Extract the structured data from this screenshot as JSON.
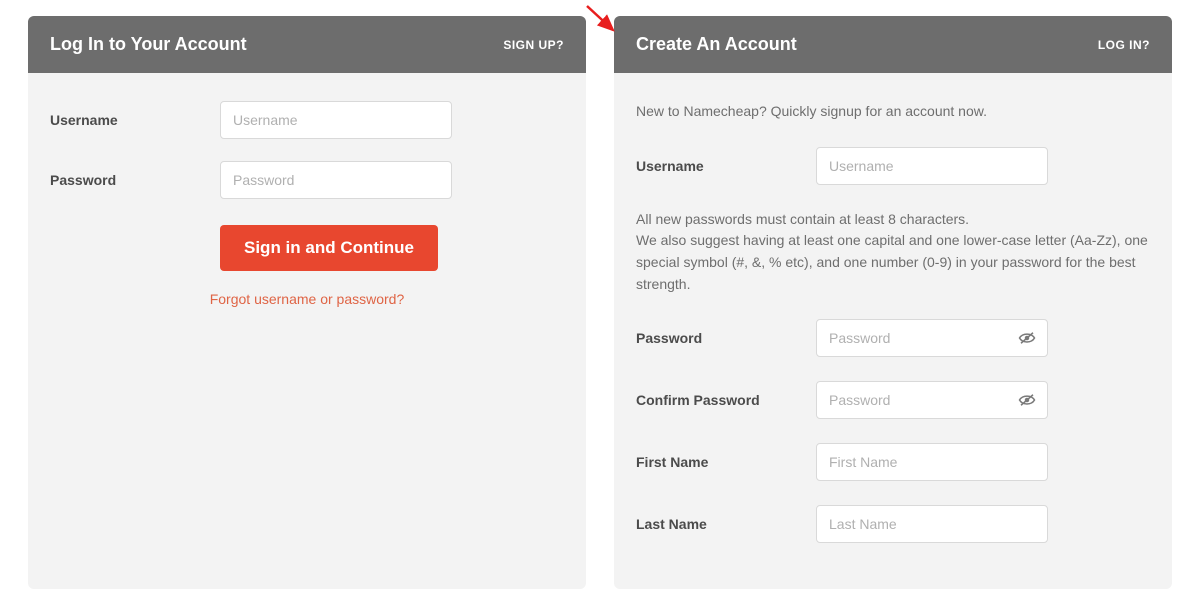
{
  "login": {
    "title": "Log In to Your Account",
    "switch_link": "SIGN UP?",
    "username_label": "Username",
    "username_placeholder": "Username",
    "password_label": "Password",
    "password_placeholder": "Password",
    "submit_label": "Sign in and Continue",
    "forgot_link": "Forgot username or password?"
  },
  "create": {
    "title": "Create An Account",
    "switch_link": "LOG IN?",
    "intro_text": "New to Namecheap? Quickly signup for an account now.",
    "username_label": "Username",
    "username_placeholder": "Username",
    "password_rules": "All new passwords must contain at least 8 characters.\nWe also suggest having at least one capital and one lower-case letter (Aa-Zz), one special symbol (#, &, % etc), and one number (0-9) in your password for the best strength.",
    "password_label": "Password",
    "password_placeholder": "Password",
    "confirm_password_label": "Confirm Password",
    "confirm_password_placeholder": "Password",
    "first_name_label": "First Name",
    "first_name_placeholder": "First Name",
    "last_name_label": "Last Name",
    "last_name_placeholder": "Last Name"
  }
}
